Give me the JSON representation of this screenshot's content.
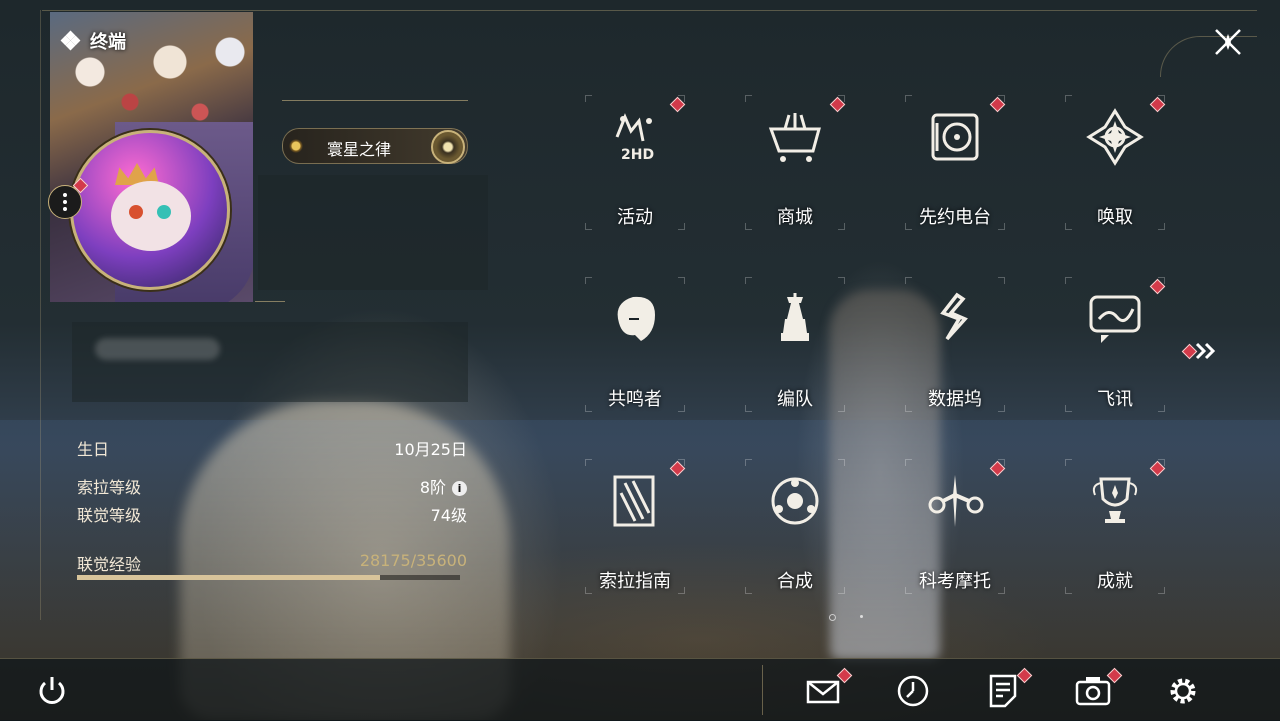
{
  "header": {
    "title": "终端"
  },
  "profile": {
    "badge_label": "寰星之律"
  },
  "stats": [
    {
      "key": "生日",
      "value": "10月25日"
    },
    {
      "key": "索拉等级",
      "value": "8阶"
    },
    {
      "key": "联觉等级",
      "value": "74级"
    }
  ],
  "experience": {
    "label": "联觉经验",
    "value": "28175/35600",
    "fraction": 0.791
  },
  "menu": [
    {
      "label": "活动",
      "icon": "event-icon",
      "badge": true
    },
    {
      "label": "商城",
      "icon": "shop-basket-icon",
      "badge": true
    },
    {
      "label": "先约电台",
      "icon": "radio-icon",
      "badge": true
    },
    {
      "label": "唤取",
      "icon": "summon-icon",
      "badge": true
    },
    {
      "label": "共鸣者",
      "icon": "resonator-icon",
      "badge": false
    },
    {
      "label": "编队",
      "icon": "team-chess-icon",
      "badge": false
    },
    {
      "label": "数据坞",
      "icon": "data-dock-icon",
      "badge": false
    },
    {
      "label": "飞讯",
      "icon": "message-icon",
      "badge": true
    },
    {
      "label": "索拉指南",
      "icon": "guide-icon",
      "badge": true
    },
    {
      "label": "合成",
      "icon": "synthesis-icon",
      "badge": false
    },
    {
      "label": "科考摩托",
      "icon": "motorcycle-icon",
      "badge": true
    },
    {
      "label": "成就",
      "icon": "trophy-icon",
      "badge": true
    }
  ],
  "pager": {
    "pages": 2,
    "current": 1
  },
  "bottom": [
    {
      "icon": "mail-icon",
      "badge": true
    },
    {
      "icon": "clock-icon",
      "badge": false
    },
    {
      "icon": "notice-icon",
      "badge": true
    },
    {
      "icon": "camera-icon",
      "badge": true
    },
    {
      "icon": "settings-icon",
      "badge": false
    }
  ],
  "colors": {
    "accent": "#c8b27a",
    "badge": "#d33a4a",
    "panel": "#1a2126"
  }
}
